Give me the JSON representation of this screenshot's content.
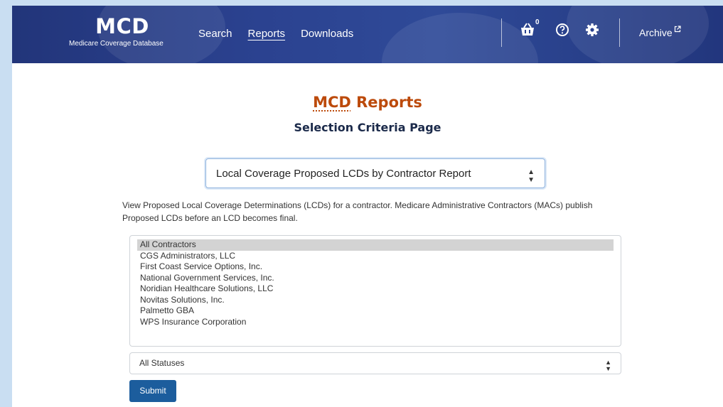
{
  "header": {
    "logo": "MCD",
    "logo_subtitle": "Medicare Coverage Database",
    "nav": [
      {
        "label": "Search"
      },
      {
        "label": "Reports"
      },
      {
        "label": "Downloads"
      }
    ],
    "cart_count": "0",
    "archive_label": "Archive",
    "icons": [
      "basket-icon",
      "help-icon",
      "gear-icon",
      "external-link-icon"
    ]
  },
  "page": {
    "title_abbr": "MCD",
    "title_rest": " Reports",
    "subtitle": "Selection Criteria Page"
  },
  "report_select": {
    "value": "Local Coverage Proposed LCDs by Contractor Report"
  },
  "description": "View Proposed Local Coverage Determinations (LCDs) for a contractor. Medicare Administrative Contractors (MACs) publish Proposed LCDs before an LCD becomes final.",
  "contractors": {
    "selected": "All Contractors",
    "options": [
      "All Contractors",
      "CGS Administrators, LLC",
      "First Coast Service Options, Inc.",
      "National Government Services, Inc.",
      "Noridian Healthcare Solutions, LLC",
      "Novitas Solutions, Inc.",
      "Palmetto GBA",
      "WPS Insurance Corporation"
    ]
  },
  "status_select": {
    "value": "All Statuses"
  },
  "submit_label": "Submit",
  "colors": {
    "header_bg": "#2b4290",
    "title": "#bc4a0b",
    "submit_bg": "#1c5d9d"
  }
}
